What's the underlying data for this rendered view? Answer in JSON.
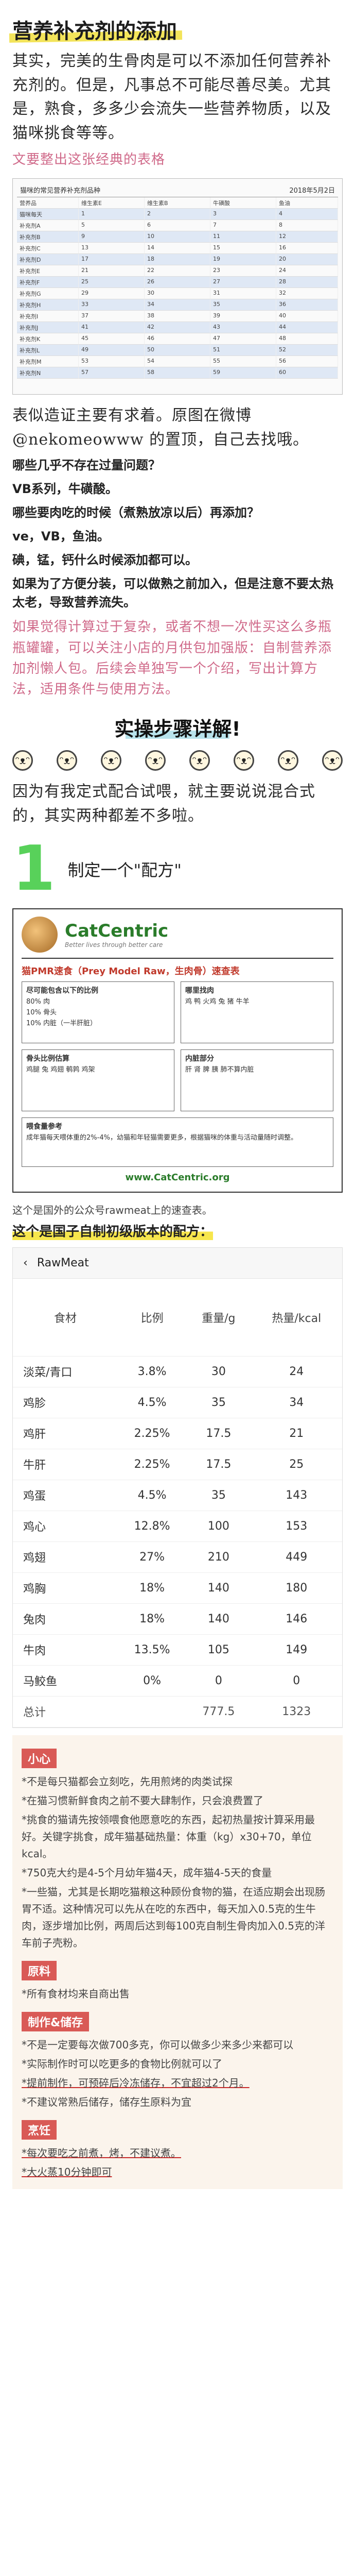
{
  "title": "营养补充剂的添加",
  "intro": "其实，完美的生骨肉是可以不添加任何营养补充剂的。但是，凡事总不可能尽善尽美。尤其是，熟食，多多少会流失一些营养物质，以及猫咪挑食等等。",
  "intro_pink": "文要整出这张经典的表格",
  "table1": {
    "title": "猫咪的常见营养补充剂品种",
    "date": "2018年5月2日",
    "rows": [
      [
        "营养品",
        "维生素E",
        "维生素B",
        "牛磺酸",
        "鱼油"
      ],
      [
        "猫咪每天",
        "1",
        "2",
        "3",
        "4"
      ],
      [
        "补充剂A",
        "5",
        "6",
        "7",
        "8"
      ],
      [
        "补充剂B",
        "9",
        "10",
        "11",
        "12"
      ],
      [
        "补充剂C",
        "13",
        "14",
        "15",
        "16"
      ],
      [
        "补充剂D",
        "17",
        "18",
        "19",
        "20"
      ],
      [
        "补充剂E",
        "21",
        "22",
        "23",
        "24"
      ],
      [
        "补充剂F",
        "25",
        "26",
        "27",
        "28"
      ],
      [
        "补充剂G",
        "29",
        "30",
        "31",
        "32"
      ],
      [
        "补充剂H",
        "33",
        "34",
        "35",
        "36"
      ],
      [
        "补充剂I",
        "37",
        "38",
        "39",
        "40"
      ],
      [
        "补充剂J",
        "41",
        "42",
        "43",
        "44"
      ],
      [
        "补充剂K",
        "45",
        "46",
        "47",
        "48"
      ],
      [
        "补充剂L",
        "49",
        "50",
        "51",
        "52"
      ],
      [
        "补充剂M",
        "53",
        "54",
        "55",
        "56"
      ],
      [
        "补充剂N",
        "57",
        "58",
        "59",
        "60"
      ]
    ]
  },
  "after_table": "表似造证主要有求着。原图在微博@nekomeowww 的置顶，自己去找哦。",
  "q1": "哪些几乎不存在过量问题？",
  "a1": "VB系列，牛磺酸。",
  "q2": "哪些要肉吃的时候（煮熟放凉以后）再添加？",
  "a2": "ve，VB，鱼油。",
  "q3": "碘，锰，钙什么时候添加都可以。",
  "q4": "如果为了方便分装，可以做熟之前加入，但是注意不要太热太老，导致营养流失。",
  "pink_note": "如果觉得计算过于复杂，或者不想一次性买这么多瓶瓶罐罐，可以关注小店的月供包加强版：自制营养添加剂懒人包。后续会单独写一个介绍，写出计算方法，适用条件与使用方法。",
  "banner": "实操步骤详解!",
  "banner_note": "因为有我定式配合试喂，就主要说说混合式的，其实两种都差不多啦。",
  "step1_num": "1",
  "step1_text": "制定一个\"配方\"",
  "cc": {
    "brand": "CatCentric",
    "slogan": "Better lives through better care",
    "subtitle": "猫PMR速食（Prey Model Raw，生肉骨）速查表",
    "box1_title": "尽可能包含以下的比例",
    "box1": "80% 肉\n10% 骨头\n10% 内脏（一半肝脏）",
    "box2_title": "哪里找肉",
    "box2": "鸡 鸭 火鸡 兔 猪 牛羊",
    "box3_title": "骨头比例估算",
    "box3": "鸡腿 兔 鸡翅 鹌鹑 鸡架",
    "box4_title": "内脏部分",
    "box4": "肝 肾 脾 胰 肺不算内脏",
    "box5_title": "喂食量参考",
    "box5": "成年猫每天喂体重的2%-4%，幼猫和年轻猫需要更多，根据猫咪的体重与活动量随时调整。",
    "url": "www.CatCentric.org"
  },
  "caption1": "这个是国外的公众号rawmeat上的速查表。",
  "caption2": "这个是国子自制初级版本的配方：",
  "rawmeat": {
    "app_title": "RawMeat",
    "headers": [
      "食材",
      "比例",
      "重量/g",
      "热量/kcal"
    ],
    "rows": [
      [
        "淡菜/青口",
        "3.8%",
        "30",
        "24"
      ],
      [
        "鸡胗",
        "4.5%",
        "35",
        "34"
      ],
      [
        "鸡肝",
        "2.25%",
        "17.5",
        "21"
      ],
      [
        "牛肝",
        "2.25%",
        "17.5",
        "25"
      ],
      [
        "鸡蛋",
        "4.5%",
        "35",
        "143"
      ],
      [
        "鸡心",
        "12.8%",
        "100",
        "153"
      ],
      [
        "鸡翅",
        "27%",
        "210",
        "449"
      ],
      [
        "鸡胸",
        "18%",
        "140",
        "180"
      ],
      [
        "兔肉",
        "18%",
        "140",
        "146"
      ],
      [
        "牛肉",
        "13.5%",
        "105",
        "149"
      ],
      [
        "马鲛鱼",
        "0%",
        "0",
        "0"
      ],
      [
        "总计",
        "",
        "777.5",
        "1323"
      ]
    ]
  },
  "notes": {
    "tag_small": "小心",
    "small_p1": "*不是每只猫都会立刻吃，先用煎烤的肉类试探",
    "small_p2": "*在猫习惯新鲜食肉之前不要大肆制作，只会浪费置了",
    "small_p3": "*挑食的猫请先按领喂食他愿意吃的东西，起初热量按计算采用最好。关键字挑食，成年猫基础热量：体重（kg）x30+70，单位kcal。",
    "small_p4": "*750克大约是4-5个月幼年猫4天，成年猫4-5天的食量",
    "small_p5": "*一些猫，尤其是长期吃猫粮这种顾份食物的猫，在适应期会出现肠胃不适。这种情况可以先从在吃的东西中，每天加入0.5克的生牛肉，逐步增加比例，两周后达到每100克自制生骨肉加入0.5克的洋车前子壳粉。",
    "tag_raw": "原料",
    "raw_p1": "*所有食材均来自商出售",
    "tag_make": "制作&储存",
    "make_p1": "*不是一定要每次做700多克，你可以做多少来多少来都可以",
    "make_p2": "*实际制作时可以吃更多的食物比例就可以了",
    "make_p3": "*提前制作，可预碎后冷冻储存，不宜超过2个月。",
    "make_p4": "*不建议常熟后储存，储存生原料为宜",
    "tag_cook": "烹饪",
    "cook_p1": "*每次要吃之前煮，烤，不建议煮。",
    "cook_p2": "*大火蒸10分钟即可"
  }
}
